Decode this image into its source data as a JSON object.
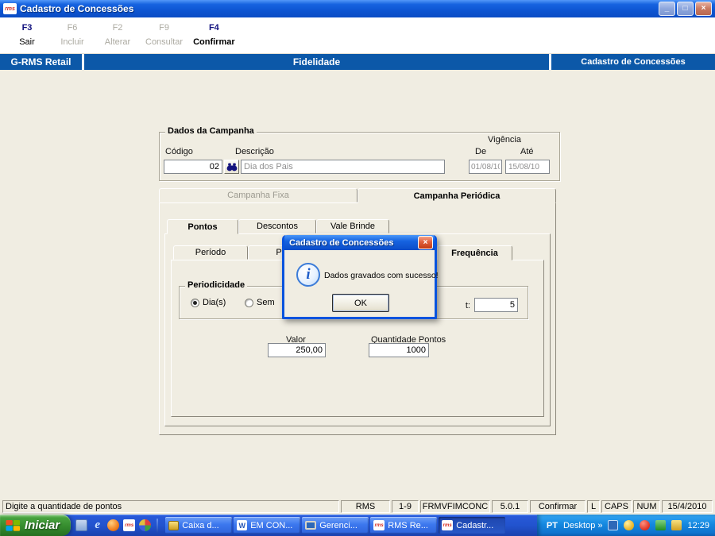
{
  "window": {
    "title": "Cadastro de Concessões"
  },
  "icons": {
    "minimize": "_",
    "restore": "□",
    "close": "×",
    "info": "i",
    "ie_letter": "e",
    "word_letter": "W",
    "rms_text": "rms",
    "chevron": "»"
  },
  "toolbar": {
    "buttons": [
      {
        "key": "F3",
        "label": "Sair",
        "enabled": true
      },
      {
        "key": "F6",
        "label": "Incluir",
        "enabled": false
      },
      {
        "key": "F2",
        "label": "Alterar",
        "enabled": false
      },
      {
        "key": "F9",
        "label": "Consultar",
        "enabled": false
      },
      {
        "key": "F4",
        "label": "Confirmar",
        "enabled": true
      }
    ]
  },
  "banner": {
    "left": "G-RMS Retail",
    "center": "Fidelidade",
    "right": "Cadastro de Concessões"
  },
  "campanha": {
    "legend": "Dados da Campanha",
    "vigencia": "Vigência",
    "codigo_label": "Código",
    "codigo": "02",
    "descricao_label": "Descrição",
    "descricao": "Dia dos Pais",
    "de_label": "De",
    "de": "01/08/10",
    "ate_label": "Até",
    "ate": "15/08/10"
  },
  "tabs1": [
    {
      "label": "Campanha Fixa"
    },
    {
      "label": "Campanha Periódica"
    }
  ],
  "tabs2": [
    {
      "label": "Pontos"
    },
    {
      "label": "Descontos"
    },
    {
      "label": "Vale Brinde"
    }
  ],
  "tabs3": [
    {
      "label": "Período"
    },
    {
      "label": "P"
    },
    {
      "label": ""
    },
    {
      "label": "Frequência"
    }
  ],
  "periodicidade": {
    "legend": "Periodicidade",
    "radio1": "Dia(s)",
    "radio2": "Sem",
    "qty_label": "t:",
    "qty": "5"
  },
  "valores": {
    "valor_label": "Valor",
    "valor": "250,00",
    "qtd_label": "Quantidade Pontos",
    "qtd": "1000"
  },
  "dialog": {
    "title": "Cadastro de Concessões",
    "message": "Dados gravados com sucesso!",
    "ok": "OK"
  },
  "statusbar": {
    "message": "Digite a quantidade de pontos",
    "panels": [
      "RMS",
      "1-9",
      "FRMVFIMCONC",
      "5.0.1",
      "Confirmar",
      "L",
      "CAPS",
      "NUM",
      "15/4/2010"
    ]
  },
  "taskbar": {
    "start": "Iniciar",
    "tasks": [
      "Caixa d...",
      "EM CON...",
      "Gerenci...",
      "RMS Re...",
      "Cadastr..."
    ],
    "lang": "PT",
    "desktop_toolbar": "Desktop",
    "clock": "12:29"
  },
  "colors": {
    "titlebar_blue": "#0D55D2",
    "banner_blue": "#0C58A8",
    "surface_gray": "#F0EDE2",
    "taskbar_blue": "#2253CE",
    "start_green": "#358C2E",
    "dialog_close_red": "#E0603C"
  }
}
